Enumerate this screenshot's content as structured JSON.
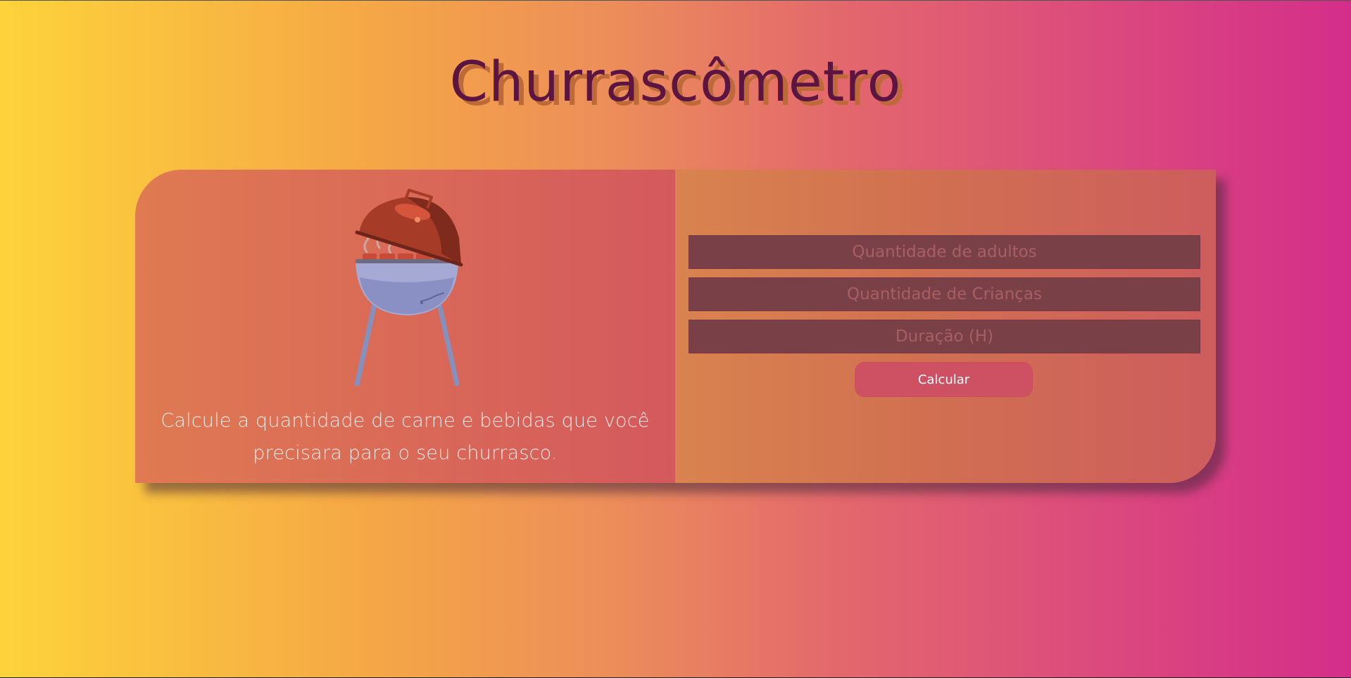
{
  "page": {
    "title": "Churrascômetro"
  },
  "intro": {
    "illustration": "barbecue-grill-icon",
    "description": "Calcule a quantidade de carne e bebidas que você precisara para o seu churrasco."
  },
  "form": {
    "adults_placeholder": "Quantidade de adultos",
    "children_placeholder": "Quantidade de Crianças",
    "duration_placeholder": "Duração (H)",
    "adults_value": "",
    "children_value": "",
    "duration_value": "",
    "submit_label": "Calcular"
  },
  "colors": {
    "gradient_start": "#fdd33a",
    "gradient_end": "#d42e8a",
    "title": "#5c1440",
    "title_shadow": "#bd6a38",
    "input_bg": "#7a4048",
    "button_bg": "#cd5163"
  }
}
